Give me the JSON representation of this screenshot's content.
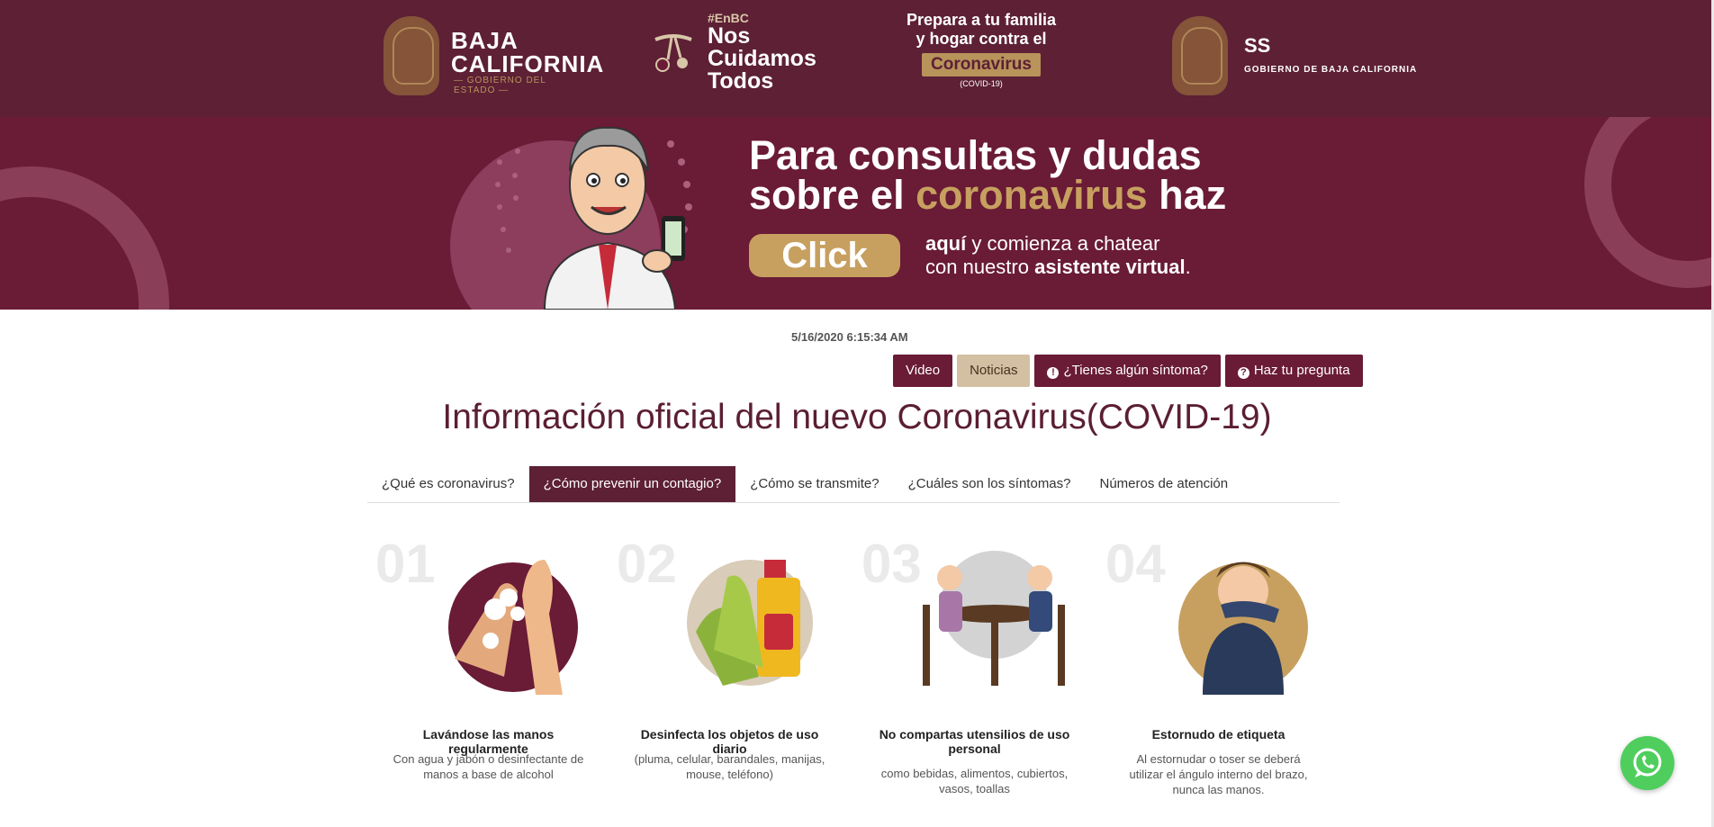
{
  "header": {
    "bc_title_line1": "BAJA",
    "bc_title_line2": "CALIFORNIA",
    "bc_sub": "— GOBIERNO DEL ESTADO —",
    "nct_hash": "#EnBC",
    "nct_line1": "Nos",
    "nct_line2": "Cuidamos",
    "nct_line3": "Todos",
    "prep_line1": "Prepara a tu familia",
    "prep_line2": "y hogar contra el",
    "prep_badge": "Coronavirus",
    "prep_sub": "(COVID-19)",
    "ss_title": "SS",
    "ss_sub": "GOBIERNO DE BAJA CALIFORNIA"
  },
  "banner": {
    "line1": "Para consultas y dudas",
    "line2_pre": "sobre el ",
    "line2_gold": "coronavirus",
    "line2_post": " haz",
    "click": "Click",
    "sub1_bold": "aquí",
    "sub1_rest": " y comienza a chatear",
    "sub2_pre": "con nuestro ",
    "sub2_bold": "asistente virtual",
    "sub2_post": "."
  },
  "timestamp": "5/16/2020 6:15:34 AM",
  "actions": {
    "video": "Video",
    "noticias": "Noticias",
    "sintoma": "¿Tienes algún síntoma?",
    "pregunta": "Haz tu pregunta"
  },
  "page_title": "Información oficial del nuevo Coronavirus(COVID-19)",
  "tabs": [
    {
      "label": "¿Qué es coronavirus?"
    },
    {
      "label": "¿Cómo prevenir un contagio?"
    },
    {
      "label": "¿Cómo se transmite?"
    },
    {
      "label": "¿Cuáles son los síntomas?"
    },
    {
      "label": "Números de atención"
    }
  ],
  "cards": [
    {
      "num": "01",
      "title": "Lavándose las manos regularmente",
      "desc": "Con agua y jabón o desinfectante de manos a base de alcohol"
    },
    {
      "num": "02",
      "title": "Desinfecta los objetos de uso diario",
      "desc": "(pluma, celular, barandales, manijas, mouse, teléfono)"
    },
    {
      "num": "03",
      "title": "No compartas utensilios de uso personal",
      "desc": "como bebidas, alimentos, cubiertos, vasos, toallas"
    },
    {
      "num": "04",
      "title": "Estornudo de etiqueta",
      "desc": "Al estornudar o toser se deberá utilizar el ángulo interno del brazo, nunca las manos."
    }
  ],
  "colors": {
    "brand": "#5d2035",
    "gold": "#c7a060",
    "whatsapp": "#4fce5d"
  }
}
